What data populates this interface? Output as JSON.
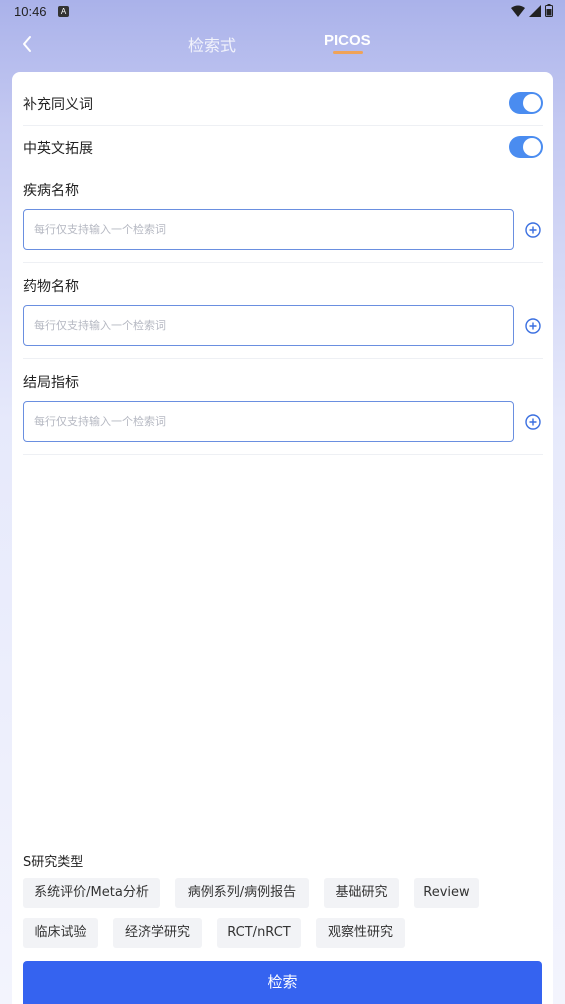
{
  "status_bar": {
    "time": "10:46",
    "badge": "A"
  },
  "nav": {
    "back_label": "‹",
    "tab_search": "检索式",
    "tab_picos": "PICOS",
    "active_tab": "PICOS",
    "underline_color": "#f0a358"
  },
  "toggles": [
    {
      "label": "补充同义词",
      "on": true
    },
    {
      "label": "中英文拓展",
      "on": true
    }
  ],
  "fields": [
    {
      "label": "疾病名称",
      "placeholder": "每行仅支持输入一个检索词",
      "value": ""
    },
    {
      "label": "药物名称",
      "placeholder": "每行仅支持输入一个检索词",
      "value": ""
    },
    {
      "label": "结局指标",
      "placeholder": "每行仅支持输入一个检索词",
      "value": ""
    }
  ],
  "study_types": {
    "title": "S研究类型",
    "chips": [
      "系统评价/Meta分析",
      "病例系列/病例报告",
      "基础研究",
      "Review",
      "临床试验",
      "经济学研究",
      "RCT/nRCT",
      "观察性研究"
    ]
  },
  "search_button": {
    "label": "检索",
    "color": "#3563f0"
  },
  "colors": {
    "accent": "#4a8cf0",
    "input_border": "#6a8fe0"
  }
}
